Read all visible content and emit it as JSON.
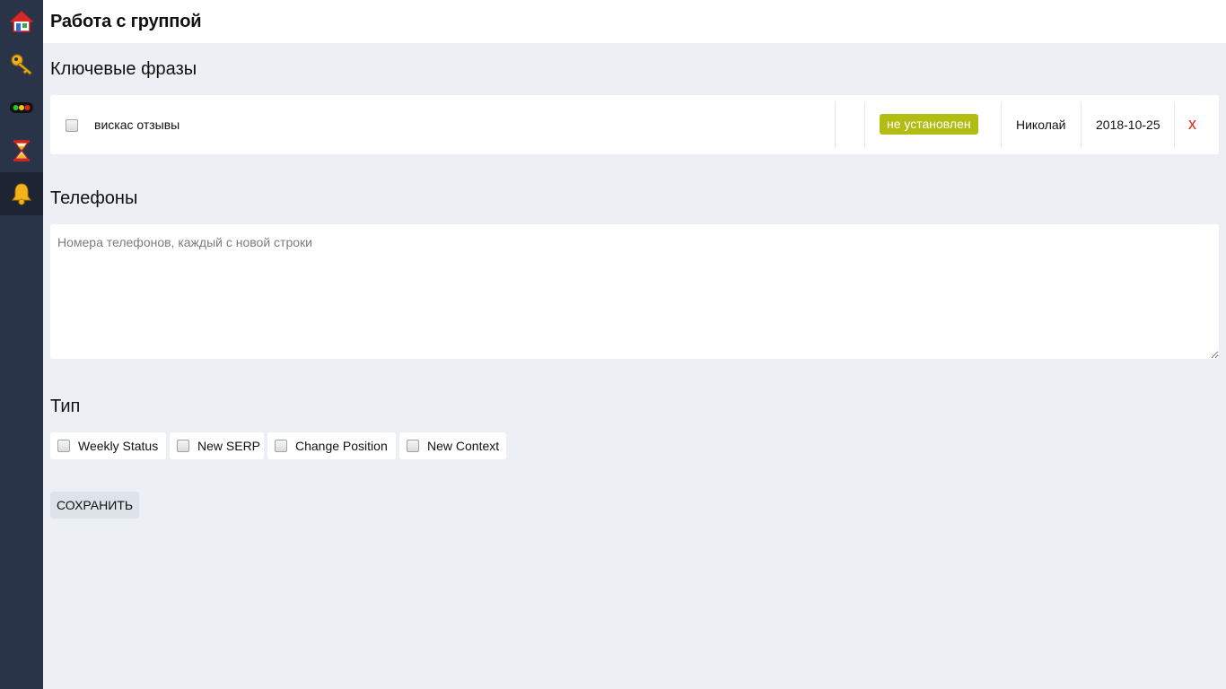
{
  "sidebar": {
    "items": [
      {
        "icon": "home-icon"
      },
      {
        "icon": "key-icon"
      },
      {
        "icon": "traffic-light-icon"
      },
      {
        "icon": "hourglass-icon"
      },
      {
        "icon": "bell-icon",
        "active": true
      }
    ]
  },
  "header": {
    "title": "Работа с группой"
  },
  "keywords": {
    "title": "Ключевые фразы",
    "rows": [
      {
        "phrase": "вискас отзывы",
        "status": "не установлен",
        "user": "Николай",
        "date": "2018-10-25",
        "delete_label": "x"
      }
    ]
  },
  "phones": {
    "title": "Телефоны",
    "placeholder": "Номера телефонов, каждый с новой строки",
    "value": ""
  },
  "type": {
    "title": "Тип",
    "options": [
      {
        "label": "Weekly Status",
        "checked": false
      },
      {
        "label": "New SERP",
        "checked": false
      },
      {
        "label": "Change Position",
        "checked": false
      },
      {
        "label": "New Context",
        "checked": false
      }
    ]
  },
  "save_label": "СОХРАНИТЬ",
  "colors": {
    "sidebar_bg": "#2a3449",
    "page_bg": "#ecf0f4",
    "status_badge": "#b1bd12",
    "delete": "#e2231a"
  }
}
